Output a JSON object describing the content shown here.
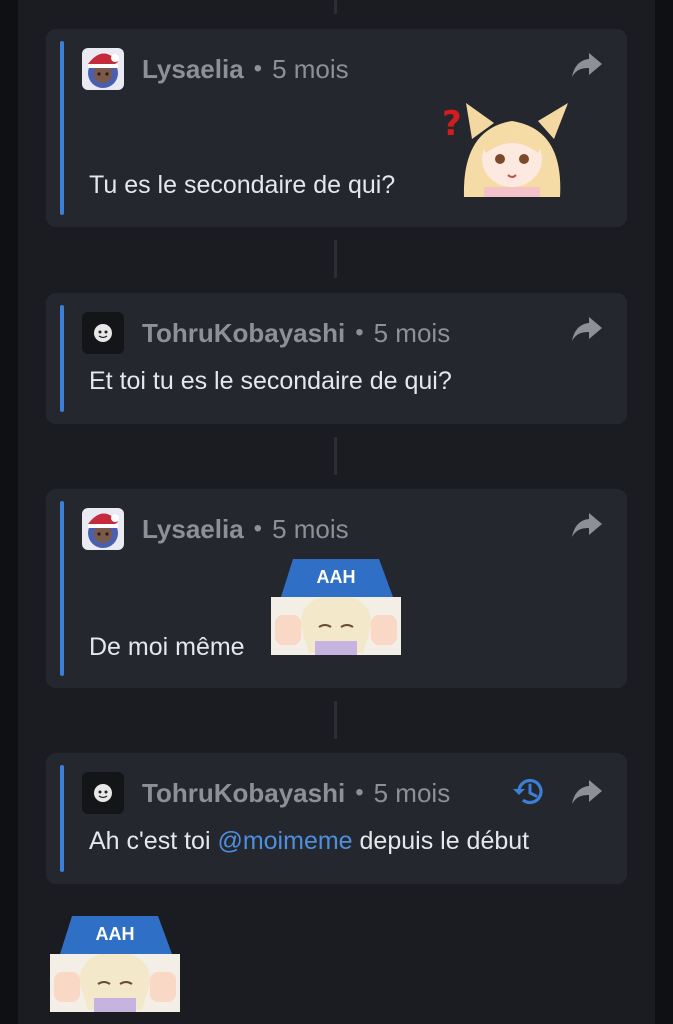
{
  "comments": [
    {
      "author": "Lysaelia",
      "separator": "•",
      "time": "5 mois",
      "text": "Tu es le secondaire de qui?"
    },
    {
      "author": "TohruKobayashi",
      "separator": "•",
      "time": "5 mois",
      "text": "Et toi tu es le secondaire de qui?"
    },
    {
      "author": "Lysaelia",
      "separator": "•",
      "time": "5 mois",
      "text": "De moi même"
    },
    {
      "author": "TohruKobayashi",
      "separator": "•",
      "time": "5 mois",
      "text_before": "Ah c'est toi",
      "mention": "@moimeme",
      "text_after": "depuis le début"
    }
  ],
  "stickers": {
    "aah_text": "AAH",
    "question_mark": "?"
  },
  "icons": {
    "share": "share-icon",
    "history": "history-icon"
  },
  "colors": {
    "accent": "#3b7fd6",
    "mention": "#4d8fdc",
    "card": "#25272e",
    "panel": "#1b1c21"
  }
}
